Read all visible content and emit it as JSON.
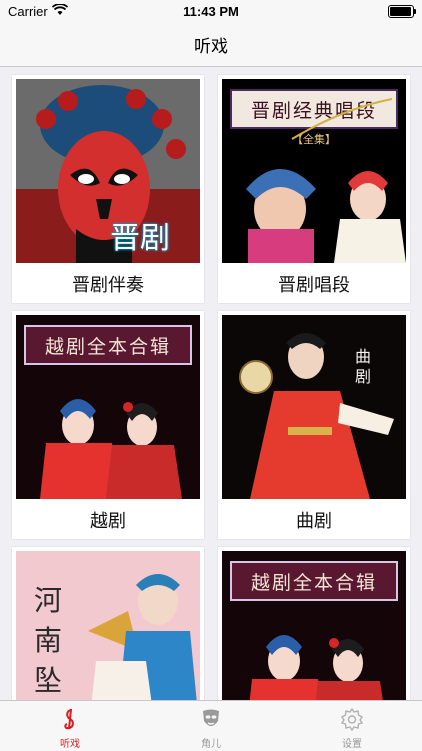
{
  "status": {
    "carrier": "Carrier",
    "time": "11:43 PM",
    "battery_level": 0.95
  },
  "nav": {
    "title": "听戏"
  },
  "cards": [
    {
      "label": "晋剧伴奏",
      "art_text": "晋剧"
    },
    {
      "label": "晋剧唱段",
      "banner": "晋剧经典唱段",
      "tag": "【全集】"
    },
    {
      "label": "越剧",
      "banner": "越剧全本合辑"
    },
    {
      "label": "曲剧",
      "art_text": "曲剧"
    },
    {
      "label": "",
      "art_text": "河南坠子"
    },
    {
      "label": "",
      "banner": "越剧全本合辑"
    }
  ],
  "tabs": [
    {
      "label": "听戏",
      "icon": "music-note-icon",
      "active": true
    },
    {
      "label": "角儿",
      "icon": "opera-mask-icon",
      "active": false
    },
    {
      "label": "设置",
      "icon": "gear-icon",
      "active": false
    }
  ],
  "colors": {
    "accent": "#d81e1e",
    "inactive": "#999999",
    "banner_bg": "#5a1730"
  }
}
